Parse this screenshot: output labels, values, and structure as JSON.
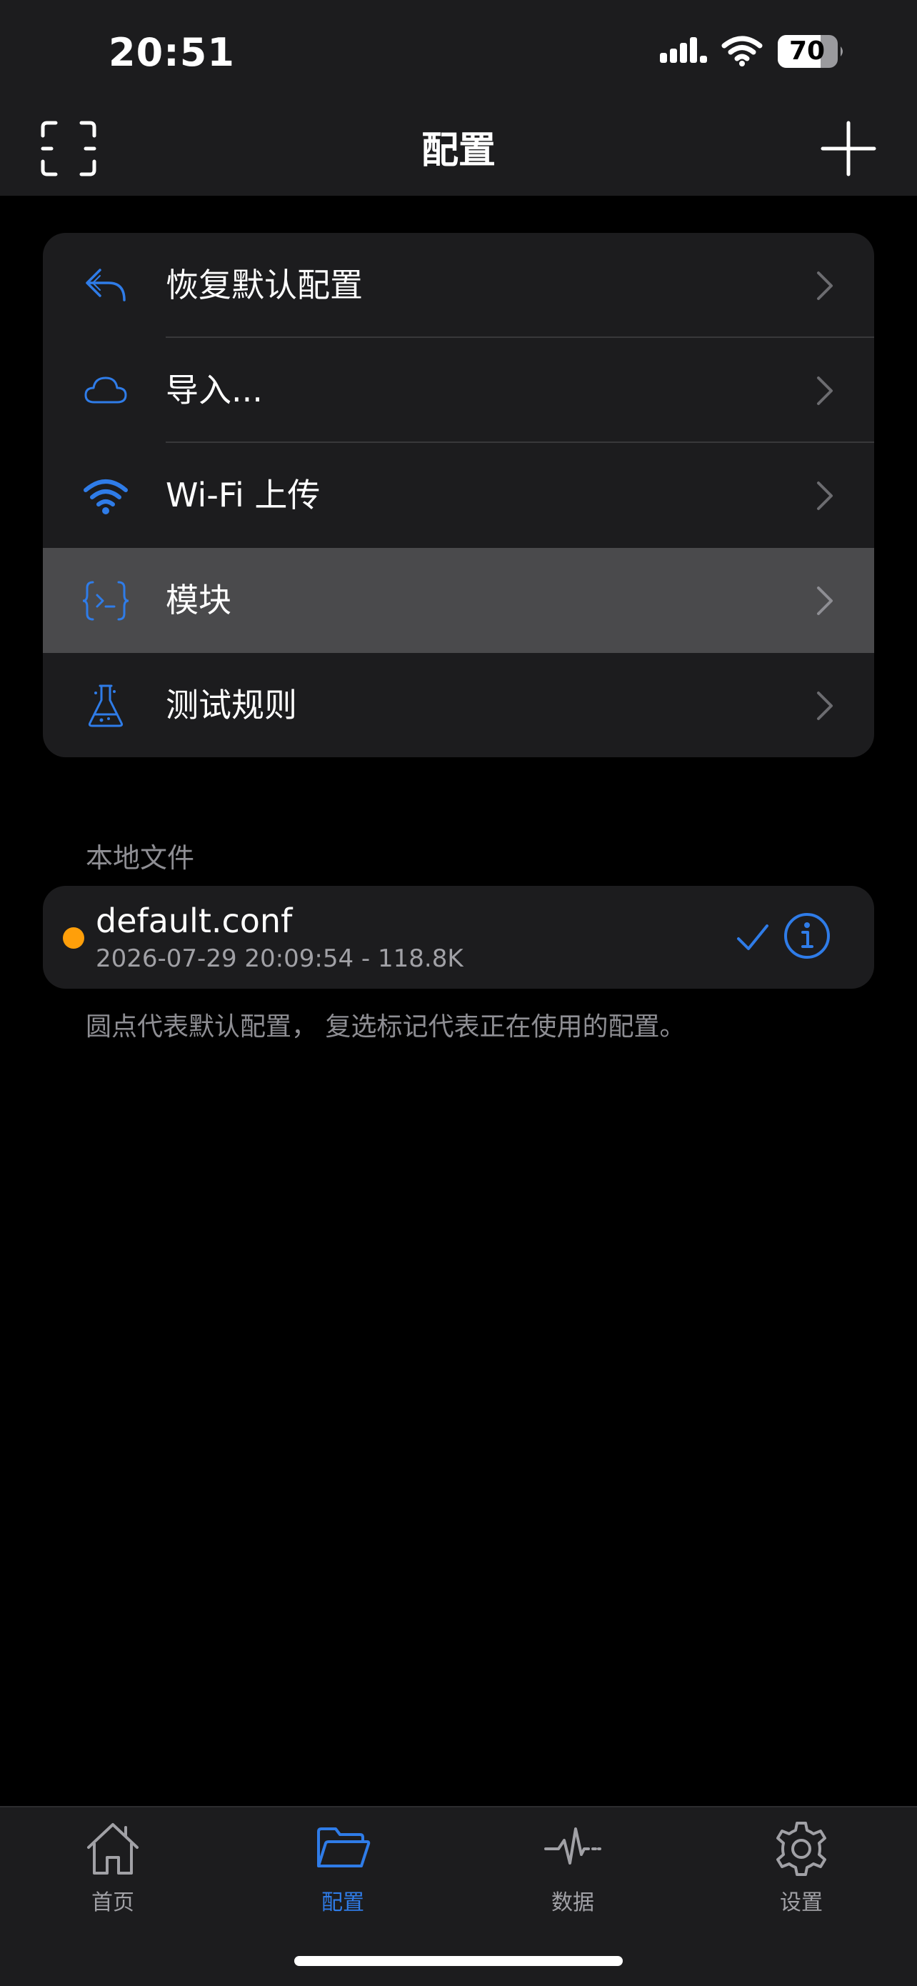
{
  "status_bar": {
    "time": "20:51",
    "battery": "70"
  },
  "nav": {
    "title": "配置",
    "left_icon": "scan-icon",
    "right_icon": "plus-icon"
  },
  "menu": {
    "items": [
      {
        "label": "恢复默认配置",
        "icon": "reply-arrow-icon"
      },
      {
        "label": "导入...",
        "icon": "cloud-icon"
      },
      {
        "label": "Wi-Fi 上传",
        "icon": "wifi-icon"
      },
      {
        "label": "模块",
        "icon": "code-braces-icon",
        "highlighted": true
      },
      {
        "label": "测试规则",
        "icon": "flask-icon"
      }
    ]
  },
  "local_files": {
    "header": "本地文件",
    "files": [
      {
        "name": "default.conf",
        "meta": "2026-07-29 20:09:54 - 118.8K",
        "is_default": true,
        "is_active": true
      }
    ],
    "footnote": "圆点代表默认配置， 复选标记代表正在使用的配置。"
  },
  "tabbar": {
    "tabs": [
      {
        "label": "首页",
        "icon": "house-icon",
        "active": false
      },
      {
        "label": "配置",
        "icon": "folder-icon",
        "active": true
      },
      {
        "label": "数据",
        "icon": "waveform-icon",
        "active": false
      },
      {
        "label": "设置",
        "icon": "gear-icon",
        "active": false
      }
    ]
  },
  "colors": {
    "accent": "#2f7ce8",
    "default_dot": "#ff9f0a",
    "background": "#000000",
    "card": "#1c1c1e",
    "highlight_row": "#4a4a4c"
  }
}
